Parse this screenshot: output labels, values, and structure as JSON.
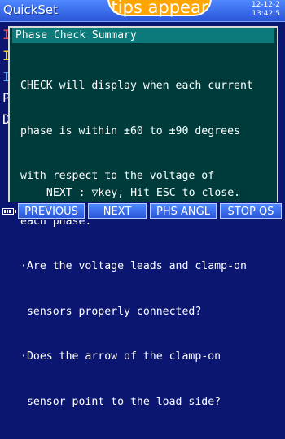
{
  "header": {
    "app_title": "QuickSet",
    "date": "12-12-2",
    "time": "13:42:5"
  },
  "tips_bubble": {
    "text": "tips appear"
  },
  "side_panel": {
    "labels": [
      "I",
      "I",
      "I",
      "P",
      "D"
    ]
  },
  "dialog": {
    "title": "Phase Check Summary",
    "body_lines": [
      "CHECK will display when each current",
      "phase is within ±60 to ±90 degrees",
      "with respect to the voltage of",
      "each phase.",
      "·Are the voltage leads and clamp-on",
      " sensors properly connected?",
      "·Does the arrow of the clamp-on",
      " sensor point to the load side?"
    ],
    "footer": "NEXT : ▽key, Hit ESC to close."
  },
  "softkeys": {
    "previous": "PREVIOUS",
    "next": "NEXT",
    "phs_angl": "PHS ANGL",
    "stop_qs": "STOP QS"
  },
  "colors": {
    "dialog_bg": "#003b3b",
    "dialog_title_bg": "#0c7a7a",
    "screen_bg": "#0a1670",
    "tips_bubble": "#ffa400"
  },
  "icons": {
    "battery": "battery-icon"
  }
}
